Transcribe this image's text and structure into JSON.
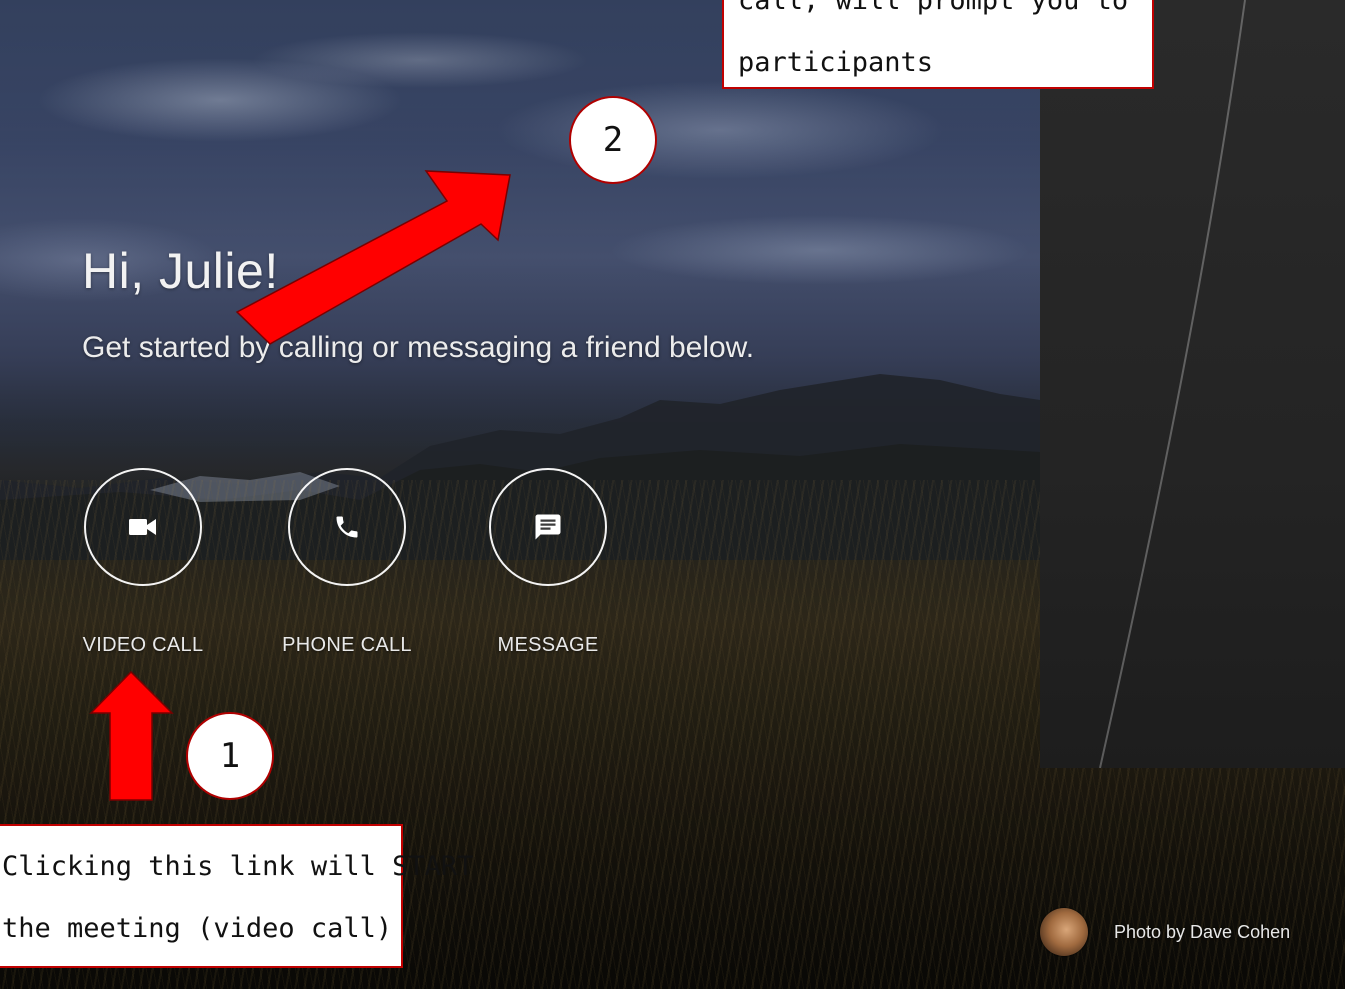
{
  "greeting": {
    "title": "Hi, Julie!",
    "subtitle": "Get started by calling or messaging a friend below."
  },
  "actions": [
    {
      "label": "VIDEO CALL",
      "icon": "video-camera-icon"
    },
    {
      "label": "PHONE CALL",
      "icon": "phone-icon"
    },
    {
      "label": "MESSAGE",
      "icon": "message-icon"
    }
  ],
  "annotations": {
    "top_note_line1": "call, will prompt you to invite",
    "top_note_line2": "participants",
    "bottom_note_line1": "Clicking this link will START",
    "bottom_note_line2": "the meeting (video call)",
    "badge_1": "1",
    "badge_2": "2"
  },
  "credit": {
    "text": "Photo by Dave Cohen"
  },
  "colors": {
    "annotation_red": "#ff0000",
    "annotation_border": "#c00000"
  }
}
